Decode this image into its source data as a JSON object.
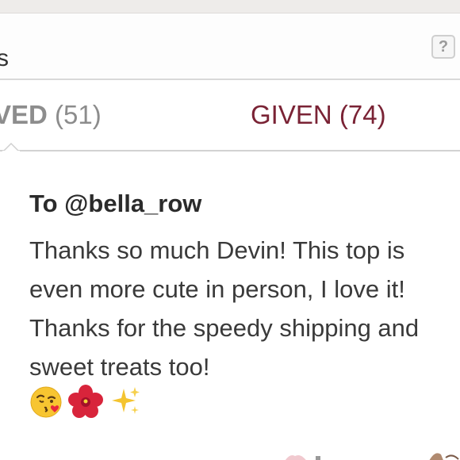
{
  "header": {
    "title": "s",
    "help_label": "?"
  },
  "tabs": {
    "received": {
      "label": "VED",
      "count": "(51)"
    },
    "given": {
      "label": "GIVEN",
      "count": "(74)"
    }
  },
  "review": {
    "to": "To @bella_row",
    "body": "Thanks so much Devin! This top is even more cute in person, I love it! Thanks for the speedy shipping and sweet treats too!",
    "emojis": [
      "kissing-heart-emoji",
      "hibiscus-emoji",
      "sparkles-emoji"
    ]
  },
  "colors": {
    "given_tab": "#7a2335",
    "received_tab": "#8d8d8d",
    "text": "#3a3a3a",
    "divider": "#d2d2d2"
  }
}
